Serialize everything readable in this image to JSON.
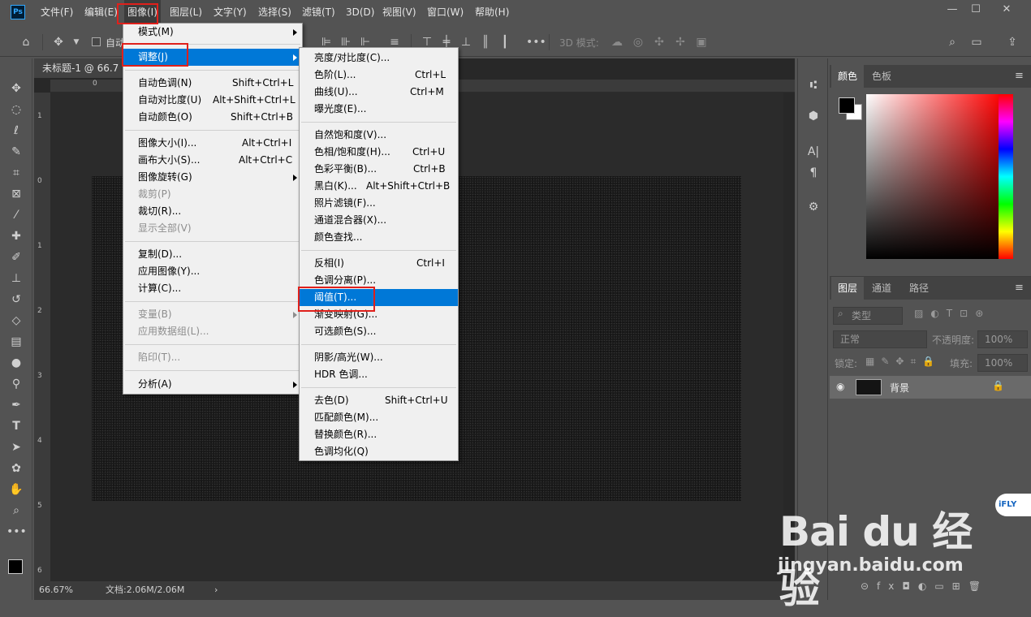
{
  "app": {
    "logo": "Ps"
  },
  "menubar": [
    {
      "label": "文件(F)"
    },
    {
      "label": "编辑(E)"
    },
    {
      "label": "图像(I)"
    },
    {
      "label": "图层(L)"
    },
    {
      "label": "文字(Y)"
    },
    {
      "label": "选择(S)"
    },
    {
      "label": "滤镜(T)"
    },
    {
      "label": "3D(D)"
    },
    {
      "label": "视图(V)"
    },
    {
      "label": "窗口(W)"
    },
    {
      "label": "帮助(H)"
    }
  ],
  "window_controls": {
    "minimize": "—",
    "restore": "☐",
    "close": "✕"
  },
  "options_bar": {
    "auto_select_label": "自动",
    "mode_3d_label": "3D 模式:"
  },
  "document": {
    "tab_title": "未标题-1 @ 66.7",
    "zoom": "66.67%",
    "doc_size": "文档:2.06M/2.06M"
  },
  "ruler_top": [
    "0",
    "1",
    "2",
    "3",
    "4",
    "5",
    "6",
    "7",
    "8",
    "9",
    "10"
  ],
  "ruler_left": [
    "1",
    "0",
    "1",
    "2",
    "3",
    "4",
    "5",
    "6"
  ],
  "image_menu": {
    "items": [
      {
        "label": "模式(M)",
        "shortcut": "",
        "submenu": true,
        "disabled": false
      },
      {
        "label": "调整(J)",
        "shortcut": "",
        "submenu": true,
        "disabled": false,
        "highlight": true
      },
      {
        "label": "自动色调(N)",
        "shortcut": "Shift+Ctrl+L"
      },
      {
        "label": "自动对比度(U)",
        "shortcut": "Alt+Shift+Ctrl+L"
      },
      {
        "label": "自动颜色(O)",
        "shortcut": "Shift+Ctrl+B"
      },
      {
        "label": "图像大小(I)...",
        "shortcut": "Alt+Ctrl+I"
      },
      {
        "label": "画布大小(S)...",
        "shortcut": "Alt+Ctrl+C"
      },
      {
        "label": "图像旋转(G)",
        "shortcut": "",
        "submenu": true
      },
      {
        "label": "裁剪(P)",
        "shortcut": "",
        "disabled": true
      },
      {
        "label": "裁切(R)...",
        "shortcut": ""
      },
      {
        "label": "显示全部(V)",
        "shortcut": "",
        "disabled": true
      },
      {
        "label": "复制(D)...",
        "shortcut": ""
      },
      {
        "label": "应用图像(Y)...",
        "shortcut": ""
      },
      {
        "label": "计算(C)...",
        "shortcut": ""
      },
      {
        "label": "变量(B)",
        "shortcut": "",
        "submenu": true,
        "disabled": true
      },
      {
        "label": "应用数据组(L)...",
        "shortcut": "",
        "disabled": true
      },
      {
        "label": "陷印(T)...",
        "shortcut": "",
        "disabled": true
      },
      {
        "label": "分析(A)",
        "shortcut": "",
        "submenu": true
      }
    ]
  },
  "adjust_menu": {
    "items": [
      {
        "label": "亮度/对比度(C)...",
        "shortcut": ""
      },
      {
        "label": "色阶(L)...",
        "shortcut": "Ctrl+L"
      },
      {
        "label": "曲线(U)...",
        "shortcut": "Ctrl+M"
      },
      {
        "label": "曝光度(E)...",
        "shortcut": ""
      },
      {
        "label": "自然饱和度(V)...",
        "shortcut": ""
      },
      {
        "label": "色相/饱和度(H)...",
        "shortcut": "Ctrl+U"
      },
      {
        "label": "色彩平衡(B)...",
        "shortcut": "Ctrl+B"
      },
      {
        "label": "黑白(K)...",
        "shortcut": "Alt+Shift+Ctrl+B"
      },
      {
        "label": "照片滤镜(F)...",
        "shortcut": ""
      },
      {
        "label": "通道混合器(X)...",
        "shortcut": ""
      },
      {
        "label": "颜色查找...",
        "shortcut": ""
      },
      {
        "label": "反相(I)",
        "shortcut": "Ctrl+I"
      },
      {
        "label": "色调分离(P)...",
        "shortcut": ""
      },
      {
        "label": "阈值(T)...",
        "shortcut": "",
        "highlight": true
      },
      {
        "label": "渐变映射(G)...",
        "shortcut": ""
      },
      {
        "label": "可选颜色(S)...",
        "shortcut": ""
      },
      {
        "label": "阴影/高光(W)...",
        "shortcut": ""
      },
      {
        "label": "HDR 色调...",
        "shortcut": ""
      },
      {
        "label": "去色(D)",
        "shortcut": "Shift+Ctrl+U"
      },
      {
        "label": "匹配颜色(M)...",
        "shortcut": ""
      },
      {
        "label": "替换颜色(R)...",
        "shortcut": ""
      },
      {
        "label": "色调均化(Q)",
        "shortcut": ""
      }
    ]
  },
  "color_panel": {
    "tabs": [
      "颜色",
      "色板"
    ]
  },
  "layers_panel": {
    "tabs": [
      "图层",
      "通道",
      "路径"
    ],
    "filter_placeholder": "类型",
    "blend_mode": "正常",
    "opacity_label": "不透明度:",
    "opacity_value": "100%",
    "lock_label": "锁定:",
    "fill_label": "填充:",
    "fill_value": "100%",
    "layers": [
      {
        "name": "背景"
      }
    ]
  },
  "watermark": {
    "brand": "Bai du 经验",
    "url": "jingyan.baidu.com",
    "badge": "iFLY"
  }
}
